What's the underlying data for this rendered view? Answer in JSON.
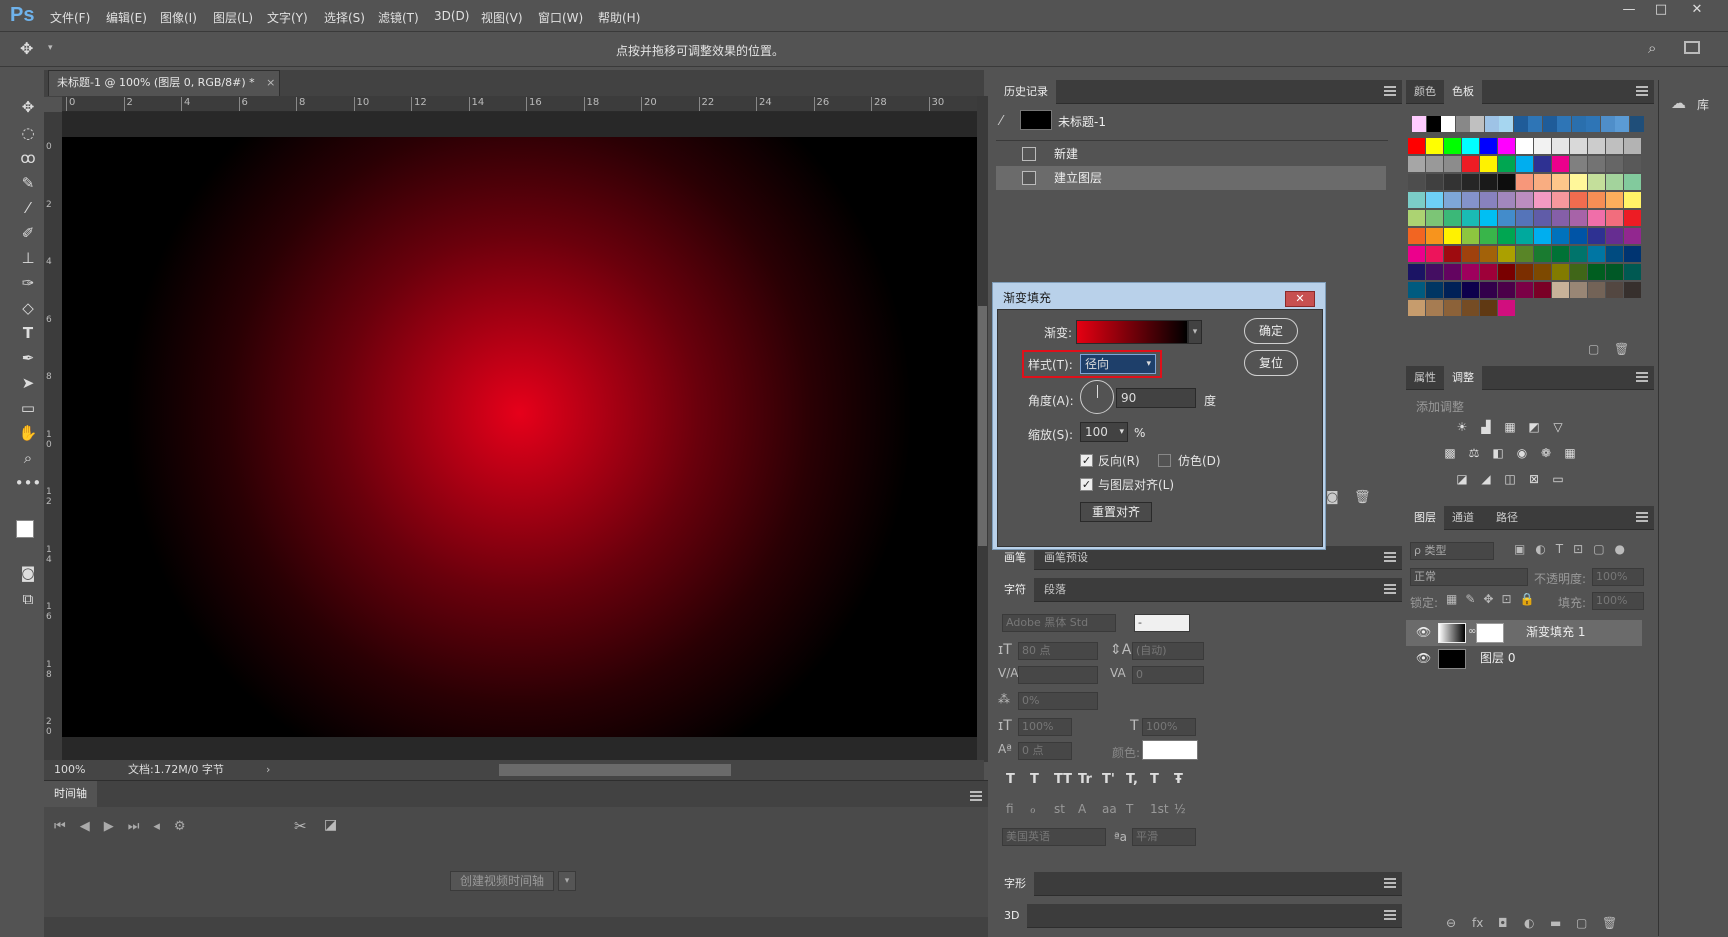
{
  "app": {
    "logo": "Ps"
  },
  "menu": [
    "文件(F)",
    "编辑(E)",
    "图像(I)",
    "图层(L)",
    "文字(Y)",
    "选择(S)",
    "滤镜(T)",
    "3D(D)",
    "视图(V)",
    "窗口(W)",
    "帮助(H)"
  ],
  "window_controls": [
    "—",
    "□",
    "✕"
  ],
  "options_bar": {
    "hint": "点按并拖移可调整效果的位置。"
  },
  "document": {
    "tab_title": "未标题-1 @ 100% (图层 0, RGB/8#) *",
    "close": "×"
  },
  "ruler_h": [
    "0",
    "2",
    "4",
    "6",
    "8",
    "10",
    "12",
    "14",
    "16",
    "18",
    "20",
    "22",
    "24",
    "26",
    "28",
    "30"
  ],
  "ruler_v": [
    "0",
    "2",
    "4",
    "6",
    "8",
    "1 0",
    "1 2",
    "1 4",
    "1 6",
    "1 8",
    "2 0"
  ],
  "status": {
    "zoom": "100%",
    "doc": "文档:1.72M/0 字节"
  },
  "timeline": {
    "tab": "时间轴",
    "create_btn": "创建视频时间轴"
  },
  "history": {
    "tab": "历史记录",
    "snapshot": "未标题-1",
    "items": [
      "新建",
      "建立图层"
    ]
  },
  "dialog": {
    "title": "渐变填充",
    "gradient_label": "渐变:",
    "style_label": "样式(T):",
    "style_value": "径向",
    "angle_label": "角度(A):",
    "angle_value": "90",
    "angle_unit": "度",
    "scale_label": "缩放(S):",
    "scale_value": "100",
    "scale_unit": "%",
    "reverse": "反向(R)",
    "dither": "仿色(D)",
    "align": "与图层对齐(L)",
    "reset_align": "重置对齐",
    "ok": "确定",
    "reset": "复位",
    "reverse_checked": true,
    "dither_checked": false,
    "align_checked": true
  },
  "brush_tabs": [
    "画笔",
    "画笔预设"
  ],
  "character": {
    "tabs": [
      "字符",
      "段落"
    ],
    "font": "Adobe 黑体 Std",
    "style": "-",
    "size": "80 点",
    "leading": "(自动)",
    "tracking": "0",
    "scale_pct": "0%",
    "vscale": "100%",
    "hscale": "100%",
    "baseline": "0 点",
    "color_label": "颜色:",
    "language": "美国英语",
    "aa": "平滑",
    "aa_icon": "ªa",
    "type_buttons": [
      "T",
      "T",
      "TT",
      "Tr",
      "T'",
      "T,",
      "T",
      "Ŧ"
    ],
    "ot_buttons": [
      "fi",
      "ℴ",
      "st",
      "A",
      "aa",
      "T",
      "1st",
      "½"
    ]
  },
  "glyph_tab": "字形",
  "three_d_tab": "3D",
  "swatches_tabs": [
    "颜色",
    "色板"
  ],
  "swatch_colors": {
    "row0": [
      "#ffccff",
      "#000000",
      "#ffffff",
      "#888888",
      "#c0c0c0",
      "#9ec3e6",
      "#a6d6f0",
      "#1f5c99",
      "#2e75b6",
      "#1f5c99",
      "#2e75b6",
      "#2a6fad",
      "#2e75b6",
      "#4f8ec9",
      "#5b9bd5",
      "#1f4e79"
    ],
    "grid": [
      [
        "#ff0000",
        "#ffff00",
        "#00ff00",
        "#00ffff",
        "#0000ff",
        "#ff00ff",
        "#ffffff",
        "#f2f2f2",
        "#e6e6e6",
        "#d9d9d9",
        "#cccccc",
        "#bfbfbf",
        "#b3b3b3"
      ],
      [
        "#a6a6a6",
        "#999999",
        "#8c8c8c",
        "#ed1c24",
        "#fff200",
        "#00a651",
        "#00aeef",
        "#2e3192",
        "#ec008c",
        "#808080",
        "#737373",
        "#666666",
        "#595959"
      ],
      [
        "#4d4d4d",
        "#404040",
        "#333333",
        "#262626",
        "#1a1a1a",
        "#0d0d0d",
        "#f7977a",
        "#f9ad81",
        "#fdc68a",
        "#fff79a",
        "#c4df9b",
        "#a3d39c",
        "#82ca9d"
      ],
      [
        "#7bcdc8",
        "#6ecff6",
        "#7ea7d8",
        "#8493ca",
        "#8882be",
        "#a187be",
        "#bc8dbf",
        "#f49ac2",
        "#f6989d",
        "#f26c4f",
        "#f68e55",
        "#fbaf5c",
        "#fff467"
      ],
      [
        "#acd372",
        "#7cc576",
        "#3bb878",
        "#1abbb4",
        "#00bff3",
        "#438ccb",
        "#5574b9",
        "#605ca8",
        "#855fa8",
        "#a763a8",
        "#f06ea9",
        "#f26d7d",
        "#ed1c24"
      ],
      [
        "#f26522",
        "#f7941d",
        "#fff200",
        "#8dc63f",
        "#39b54a",
        "#00a651",
        "#00a99d",
        "#00aeef",
        "#0072bc",
        "#0054a6",
        "#2e3192",
        "#662d91",
        "#92278f"
      ],
      [
        "#ec008c",
        "#ed145b",
        "#9e0b0f",
        "#a0410d",
        "#a36209",
        "#aba000",
        "#598527",
        "#1a7b30",
        "#007236",
        "#00746b",
        "#0076a3",
        "#004b80",
        "#003471"
      ],
      [
        "#1b1464",
        "#440e62",
        "#630460",
        "#9e005d",
        "#9e0039",
        "#790000",
        "#7b2e00",
        "#7d4900",
        "#827b00",
        "#406618",
        "#005e20",
        "#005826",
        "#005952"
      ],
      [
        "#005b7f",
        "#003663",
        "#002157",
        "#0d004c",
        "#32004b",
        "#4b0049",
        "#7b0046",
        "#7a0026",
        "#c7b299",
        "#998675",
        "#736357",
        "#534741",
        "#37302d"
      ],
      [
        "#c69c6d",
        "#a67c52",
        "#8c6239",
        "#754c24",
        "#603913",
        "#d10e7e"
      ]
    ]
  },
  "adjust_tabs": [
    "属性",
    "调整"
  ],
  "adjust_hint": "添加调整",
  "adjust_icons": [
    "☀",
    "▟",
    "▦",
    "◩",
    "▽",
    "▩",
    "⚖",
    "◧",
    "◉",
    "❁",
    "▦",
    "◪",
    "◢",
    "◫",
    "⊠",
    "▭"
  ],
  "layers": {
    "tabs": [
      "图层",
      "通道",
      "路径"
    ],
    "filter": "ρ 类型",
    "blend": "正常",
    "opacity_label": "不透明度:",
    "opacity": "100%",
    "lock_label": "锁定:",
    "fill_label": "填充:",
    "fill": "100%",
    "rows": [
      {
        "name": "渐变填充 1"
      },
      {
        "name": "图层 0"
      }
    ],
    "footer": [
      "⊖",
      "fx",
      "◘",
      "◐",
      "▬",
      "▢",
      "🗑"
    ]
  },
  "library": {
    "label": "库"
  }
}
